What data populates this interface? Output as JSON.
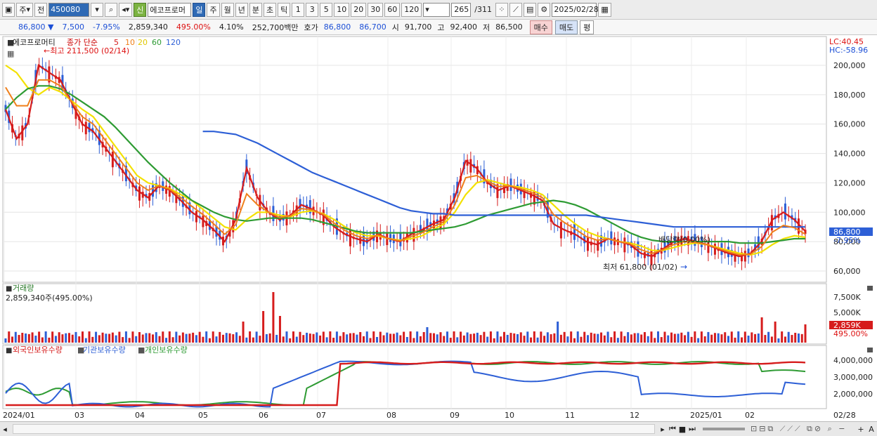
{
  "toolbar": {
    "type_main": "주",
    "type_prev": "전",
    "code": "450080",
    "new_badge": "신",
    "stock_name": "에코프로머",
    "periods": [
      "일",
      "주",
      "월",
      "년",
      "분",
      "초",
      "틱"
    ],
    "numbers": [
      "1",
      "3",
      "5",
      "10",
      "20",
      "30",
      "60",
      "120"
    ],
    "page_current": "265",
    "page_total": "/311",
    "date": "2025/02/28"
  },
  "info": {
    "price": "86,800 ▼",
    "change": "7,500",
    "change_pct": "-7.95%",
    "volume": "2,859,340",
    "volume_pct": "495.00%",
    "turnover": "4.10%",
    "amount": "252,700백만",
    "quote_label": "호가",
    "ask": "86,800",
    "bid": "86,700",
    "open_label": "시",
    "open": "91,700",
    "high_label": "고",
    "high": "92,400",
    "low_label": "저",
    "low": "86,500",
    "buy": "매수",
    "sell": "매도",
    "avg": "평"
  },
  "price_panel": {
    "name": "에코프로머티",
    "legend_label": "종가 단순",
    "ma_periods": [
      "5",
      "10",
      "20",
      "60",
      "120"
    ],
    "ma_colors": [
      "#d61c1c",
      "#ef7f1a",
      "#f3e100",
      "#2e9b33",
      "#2d5fd6"
    ],
    "high_annot": "←최고 211,500 (02/14)",
    "low_annot": "최저 61,800 (01/02)",
    "low_arrow": "→",
    "dividend_annot": "배당락(0,00%)",
    "lc": "LC:40.45",
    "hc": "HC:-58.96",
    "y_ticks": [
      "200,000",
      "180,000",
      "160,000",
      "140,000",
      "120,000",
      "100,000",
      "80,000",
      "60,000"
    ],
    "current_price_tag": "86,800",
    "current_pct_tag": "-7.95%"
  },
  "volume_panel": {
    "title": "거래량",
    "value_text": "2,859,340주(495.00%)",
    "y_ticks": [
      "7,500K",
      "5,000K"
    ],
    "current_tag": "2,859K",
    "current_pct": "495.00%"
  },
  "holdings_panel": {
    "legend": [
      "외국인보유수량",
      "기관보유수량",
      "개인보유수량"
    ],
    "legend_colors": [
      "#d61c1c",
      "#2d5fd6",
      "#2e9b33"
    ],
    "y_ticks": [
      "4,000,000",
      "3,000,000",
      "2,000,000"
    ]
  },
  "x_axis": {
    "labels": [
      "2024/01",
      "03",
      "04",
      "05",
      "06",
      "07",
      "08",
      "09",
      "10",
      "11",
      "12",
      "2025/01",
      "02"
    ],
    "end_label": "02/28"
  },
  "chart_data": {
    "type": "line",
    "price_series": [
      {
        "name": "5",
        "values": [
          170,
          150,
          160,
          200,
          195,
          190,
          175,
          160,
          155,
          145,
          135,
          125,
          115,
          110,
          118,
          115,
          108,
          100,
          95,
          88,
          80,
          95,
          130,
          110,
          100,
          95,
          98,
          105,
          102,
          98,
          90,
          85,
          82,
          80,
          85,
          82,
          80,
          85,
          88,
          92,
          95,
          110,
          135,
          130,
          120,
          115,
          118,
          115,
          112,
          108,
          92,
          88,
          85,
          80,
          78,
          82,
          80,
          78,
          72,
          70,
          75,
          80,
          82,
          80,
          78,
          75,
          72,
          70,
          72,
          80,
          95,
          100,
          95,
          87
        ]
      },
      {
        "name": "20",
        "values": [
          200,
          195,
          185,
          180,
          185,
          182,
          176,
          170,
          165,
          155,
          145,
          135,
          125,
          120,
          118,
          116,
          112,
          108,
          102,
          96,
          90,
          88,
          95,
          100,
          100,
          98,
          97,
          100,
          101,
          99,
          95,
          90,
          86,
          84,
          84,
          82,
          81,
          82,
          84,
          88,
          92,
          100,
          112,
          120,
          122,
          120,
          118,
          117,
          115,
          112,
          105,
          98,
          92,
          87,
          84,
          82,
          80,
          79,
          77,
          74,
          74,
          76,
          78,
          79,
          78,
          76,
          74,
          72,
          71,
          73,
          78,
          82,
          84,
          83
        ]
      },
      {
        "name": "60",
        "values": [
          170,
          178,
          184,
          186,
          186,
          184,
          180,
          175,
          170,
          165,
          158,
          150,
          142,
          134,
          127,
          120,
          114,
          108,
          104,
          100,
          97,
          95,
          94,
          95,
          96,
          96,
          96,
          96,
          95,
          93,
          91,
          89,
          87,
          86,
          86,
          86,
          86,
          86,
          87,
          88,
          89,
          90,
          92,
          95,
          98,
          100,
          102,
          104,
          106,
          107,
          108,
          107,
          105,
          102,
          98,
          94,
          90,
          86,
          83,
          81,
          80,
          80,
          80,
          80,
          80,
          80,
          80,
          79,
          79,
          79,
          80,
          81,
          82,
          82
        ]
      },
      {
        "name": "120",
        "values": [
          null,
          null,
          null,
          null,
          null,
          null,
          null,
          null,
          null,
          null,
          null,
          null,
          null,
          null,
          null,
          null,
          null,
          null,
          155,
          155,
          154,
          153,
          150,
          147,
          143,
          139,
          135,
          131,
          127,
          124,
          121,
          118,
          115,
          112,
          109,
          106,
          103,
          101,
          100,
          99,
          99,
          98,
          98,
          98,
          98,
          98,
          98,
          98,
          98,
          98,
          98,
          98,
          98,
          98,
          97,
          96,
          95,
          94,
          93,
          92,
          91,
          90,
          90,
          90,
          90,
          90,
          90,
          90,
          90,
          90,
          90,
          90,
          90,
          90
        ]
      }
    ],
    "x_labels": [
      "2024/01",
      "03",
      "04",
      "05",
      "06",
      "07",
      "08",
      "09",
      "10",
      "11",
      "12",
      "2025/01",
      "02",
      "02/28"
    ]
  }
}
